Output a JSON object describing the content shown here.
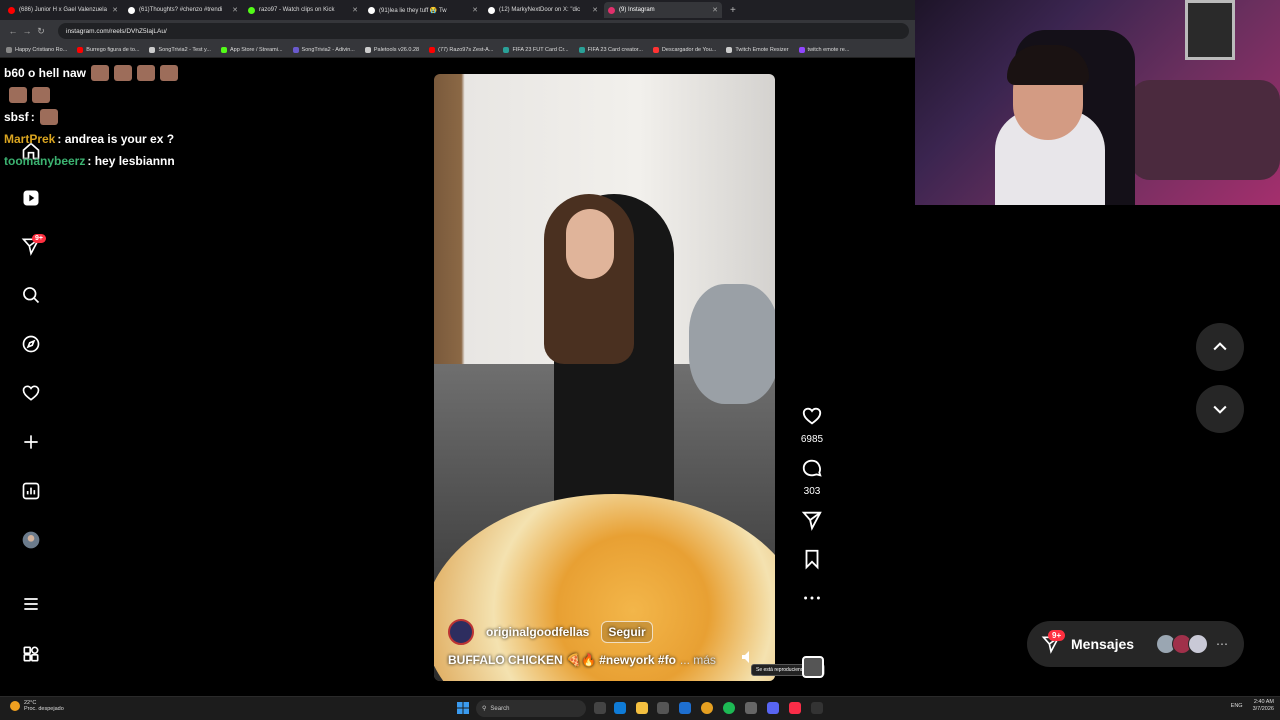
{
  "browser": {
    "tabs": [
      {
        "title": "(686) Junior H x Gael Valenzuela",
        "color": "#ff0000"
      },
      {
        "title": "(61)Thoughts? #chenzo #trendi",
        "color": "#ffffff"
      },
      {
        "title": "razo97 - Watch clips on Kick",
        "color": "#53fc18"
      },
      {
        "title": "(91)lea lie they tuff 😭 Tw",
        "color": "#ffffff"
      },
      {
        "title": "(12) MarkyNextDoor on X: \"dic",
        "color": "#ffffff"
      },
      {
        "title": "(9) Instagram",
        "color": "#e1306c",
        "active": true
      }
    ],
    "url": "instagram.com/reels/DVhZ5IajLAu/",
    "bookmarks": [
      {
        "label": "Happy Cristiano Ro...",
        "color": "#888888"
      },
      {
        "label": "Burrego figura de to...",
        "color": "#ff0000"
      },
      {
        "label": "SongTrivia2 - Test y...",
        "color": "#cccccc"
      },
      {
        "label": "App Store / Streami...",
        "color": "#53fc18"
      },
      {
        "label": "SongTrivia2 - Adivin...",
        "color": "#6a5acd"
      },
      {
        "label": "Paletools v26.0.28",
        "color": "#cccccc"
      },
      {
        "label": "(77) Razo97s Zest-A...",
        "color": "#ff0000"
      },
      {
        "label": "FIFA 23 FUT Card Cr...",
        "color": "#2aa198"
      },
      {
        "label": "FIFA 23 Card creator...",
        "color": "#2aa198"
      },
      {
        "label": "Descargador de You...",
        "color": "#ff3333"
      },
      {
        "label": "Twitch Emote Resizer",
        "color": "#cccccc"
      },
      {
        "label": "twitch emote re...",
        "color": "#9146ff"
      }
    ]
  },
  "chat": [
    {
      "user": "",
      "text": "b60 o hell naw",
      "user_color": "#ffffff",
      "emotes": 4
    },
    {
      "user": "",
      "text": "",
      "user_color": "#ffffff",
      "emotes": 2
    },
    {
      "user": "sbsf",
      "text": ":",
      "user_color": "#ffffff",
      "emotes": 1
    },
    {
      "user": "MartPrek",
      "text": ": andrea is your ex ?",
      "user_color": "#daa520",
      "emotes": 0
    },
    {
      "user": "toomanybeerz",
      "text": ": hey lesbiannn",
      "user_color": "#3cb371",
      "emotes": 0
    }
  ],
  "sidebar": {
    "notification_badge": "9+",
    "items": [
      {
        "name": "home-icon"
      },
      {
        "name": "reels-icon"
      },
      {
        "name": "messages-icon"
      },
      {
        "name": "search-icon"
      },
      {
        "name": "explore-icon"
      },
      {
        "name": "notifications-icon"
      },
      {
        "name": "create-icon"
      },
      {
        "name": "dashboard-icon"
      },
      {
        "name": "profile-avatar"
      },
      {
        "name": "menu-icon"
      },
      {
        "name": "more-apps-icon"
      }
    ]
  },
  "reel": {
    "account": "originalgoodfellas",
    "follow_label": "Seguir",
    "caption": "BUFFALO CHICKEN 🍕🔥 #newyork #fo",
    "more_label": "... más",
    "audio_tooltip": "Se está reproduciendo audio",
    "likes": "6985",
    "comments": "303"
  },
  "right_panel": {
    "messages_label": "Mensajes",
    "messages_badge": "9+"
  },
  "taskbar": {
    "weather_temp": "22°C",
    "weather_desc": "Proc. despejado",
    "search_placeholder": "Search",
    "lang": "ENG",
    "time": "2:40 AM",
    "date": "3/7/2026"
  },
  "colors": {
    "accent_badge": "#ff3040",
    "panel_bg": "#262626"
  }
}
